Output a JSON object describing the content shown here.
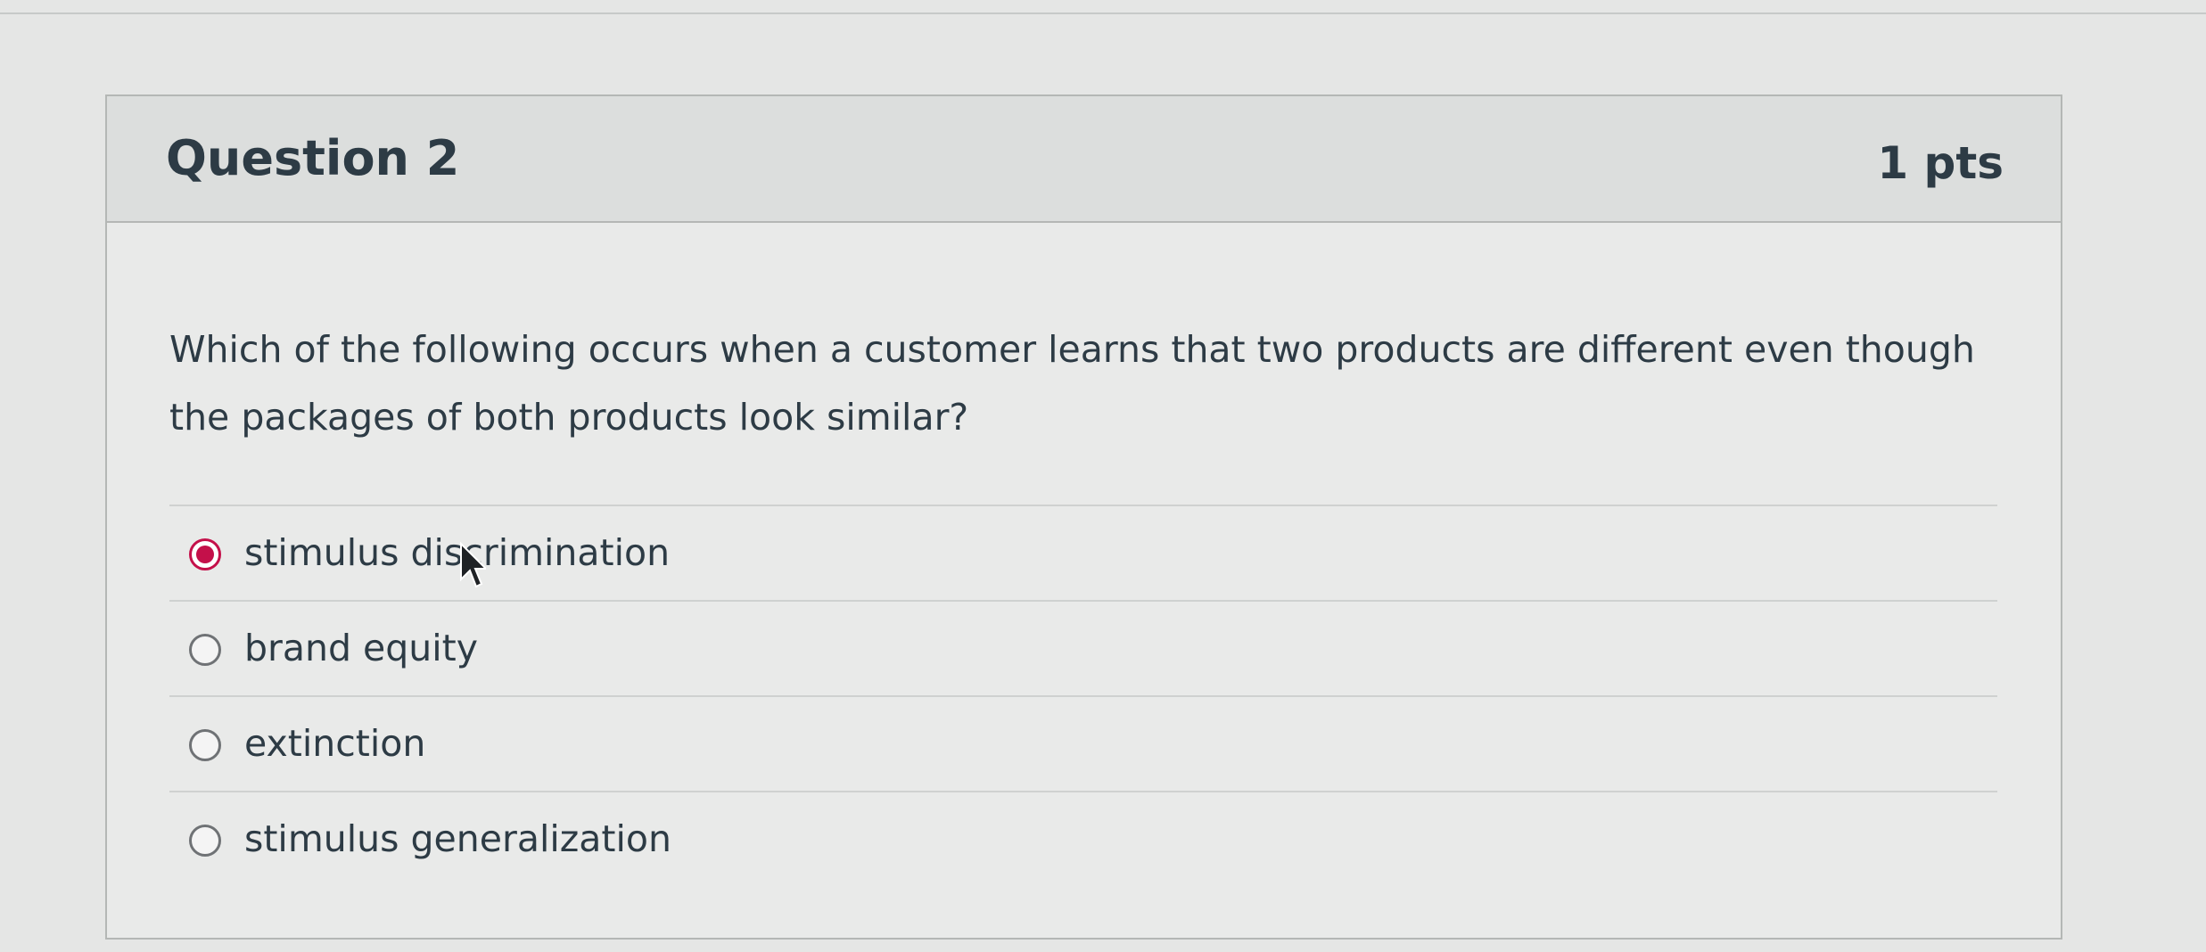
{
  "question": {
    "title": "Question 2",
    "points": "1 pts",
    "text": "Which of the following occurs when a customer learns that two products are different even though the packages of both products look similar?"
  },
  "answers": [
    {
      "label": "stimulus discrimination",
      "selected": true
    },
    {
      "label": "brand equity",
      "selected": false
    },
    {
      "label": "extinction",
      "selected": false
    },
    {
      "label": "stimulus generalization",
      "selected": false
    }
  ],
  "colors": {
    "selected_radio": "#c4104a",
    "text": "#2d3b45",
    "background": "#e5e6e5",
    "header_background": "#dcdedd"
  },
  "icons": {
    "cursor": "mouse-pointer-icon"
  }
}
